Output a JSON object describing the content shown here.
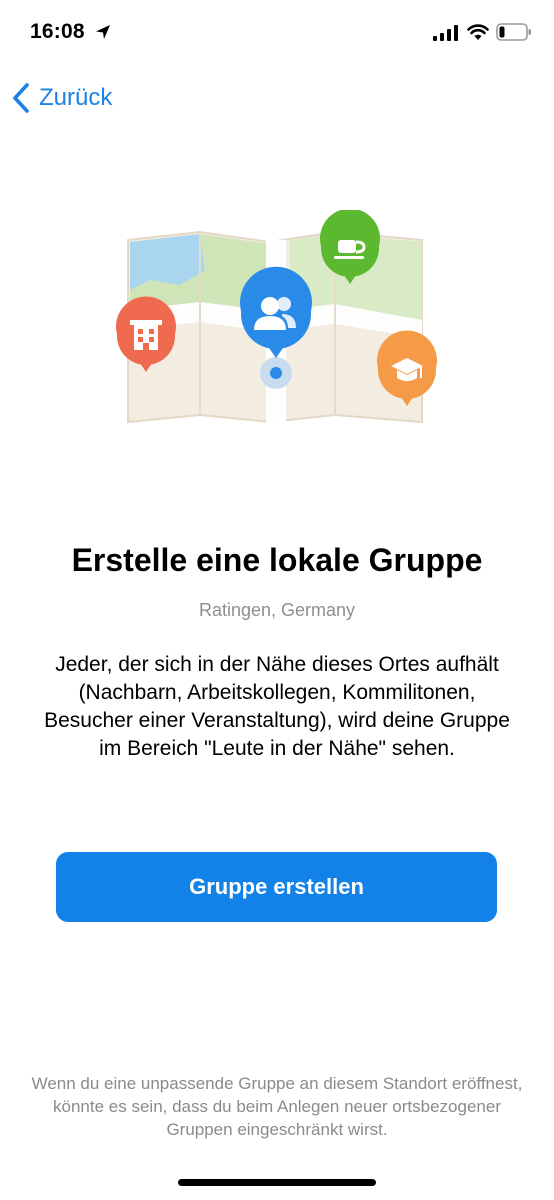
{
  "status_bar": {
    "time": "16:08",
    "icons": [
      "location-arrow-icon",
      "cellular-signal-icon",
      "wifi-icon",
      "battery-icon"
    ]
  },
  "nav": {
    "back_label": "Zurück",
    "back_icon": "chevron-left-icon"
  },
  "illustration": {
    "icons": [
      "map-icon",
      "people-pin-icon",
      "coffee-pin-icon",
      "building-pin-icon",
      "graduation-cap-pin-icon"
    ],
    "colors": {
      "people_pin": "#2a8ae8",
      "coffee_pin": "#5cb82e",
      "building_pin": "#ef6a4f",
      "graduation_pin": "#f59a47"
    }
  },
  "content": {
    "title": "Erstelle eine lokale Gruppe",
    "location": "Ratingen, Germany",
    "description": "Jeder, der sich in der Nähe dieses Ortes aufhält (Nachbarn, Arbeitskollegen, Kommilitonen, Besucher einer Veranstaltung), wird deine Gruppe im Bereich \"Leute in der Nähe\" sehen.",
    "button_label": "Gruppe erstellen",
    "footer_note": "Wenn du eine unpassende Gruppe an diesem Standort eröffnest, könnte es sein, dass du beim Anlegen neuer ortsbezogener Gruppen eingeschränkt wirst."
  },
  "colors": {
    "accent": "#1282e8",
    "secondary_text": "#8e8e93"
  }
}
